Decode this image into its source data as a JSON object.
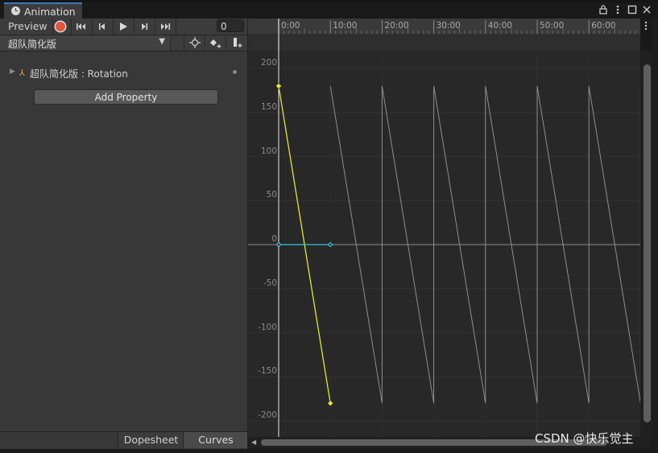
{
  "window": {
    "tab_title": "Animation",
    "controls": [
      "lock-icon",
      "menu-icon",
      "maximize-icon",
      "close-icon"
    ]
  },
  "toolbar": {
    "preview_label": "Preview",
    "record_color": "#e0573a",
    "buttons": [
      "record-icon",
      "first-key-icon",
      "prev-key-icon",
      "play-icon",
      "next-key-icon",
      "last-key-icon"
    ],
    "frame_value": "0"
  },
  "clip_selector": {
    "value": "超队简化版",
    "key_buttons": [
      "filter-by-selection-icon",
      "add-keyframe-icon",
      "add-event-icon"
    ]
  },
  "properties": [
    {
      "object": "超队简化版",
      "property": "Rotation",
      "label": "超队简化版 : Rotation"
    }
  ],
  "add_property_label": "Add Property",
  "modes": {
    "dopesheet": "Dopesheet",
    "curves": "Curves",
    "active": "curves"
  },
  "timeline": {
    "tick_labels": [
      "0:00",
      "10:00",
      "20:00",
      "30:00",
      "40:00",
      "50:00",
      "60:00"
    ],
    "overflow_menu_icon": "kebab-icon"
  },
  "chart_data": {
    "type": "line",
    "x_unit": "seconds:frames",
    "x": [
      0,
      10,
      20,
      30,
      40,
      50,
      60,
      70
    ],
    "ylim": [
      -200,
      200
    ],
    "y_ticks": [
      200,
      150,
      100,
      50,
      0,
      -50,
      -100,
      -150,
      -200
    ],
    "series": [
      {
        "color": "#e6e62e",
        "points": [
          [
            0,
            180
          ],
          [
            10,
            -180
          ]
        ]
      },
      {
        "color": "#2ec8d8",
        "points": [
          [
            0,
            0
          ],
          [
            10,
            0
          ]
        ]
      },
      {
        "color": "#8e8e8e",
        "points": [
          [
            10,
            180
          ],
          [
            20,
            -180
          ],
          [
            20,
            180
          ],
          [
            30,
            -180
          ],
          [
            30,
            180
          ],
          [
            40,
            -180
          ],
          [
            40,
            180
          ],
          [
            50,
            -180
          ],
          [
            50,
            180
          ],
          [
            60,
            -180
          ],
          [
            60,
            180
          ],
          [
            70,
            -180
          ],
          [
            70,
            180
          ],
          [
            72,
            -180
          ]
        ]
      }
    ],
    "grid": true
  },
  "watermark": "CSDN @快乐觉主"
}
